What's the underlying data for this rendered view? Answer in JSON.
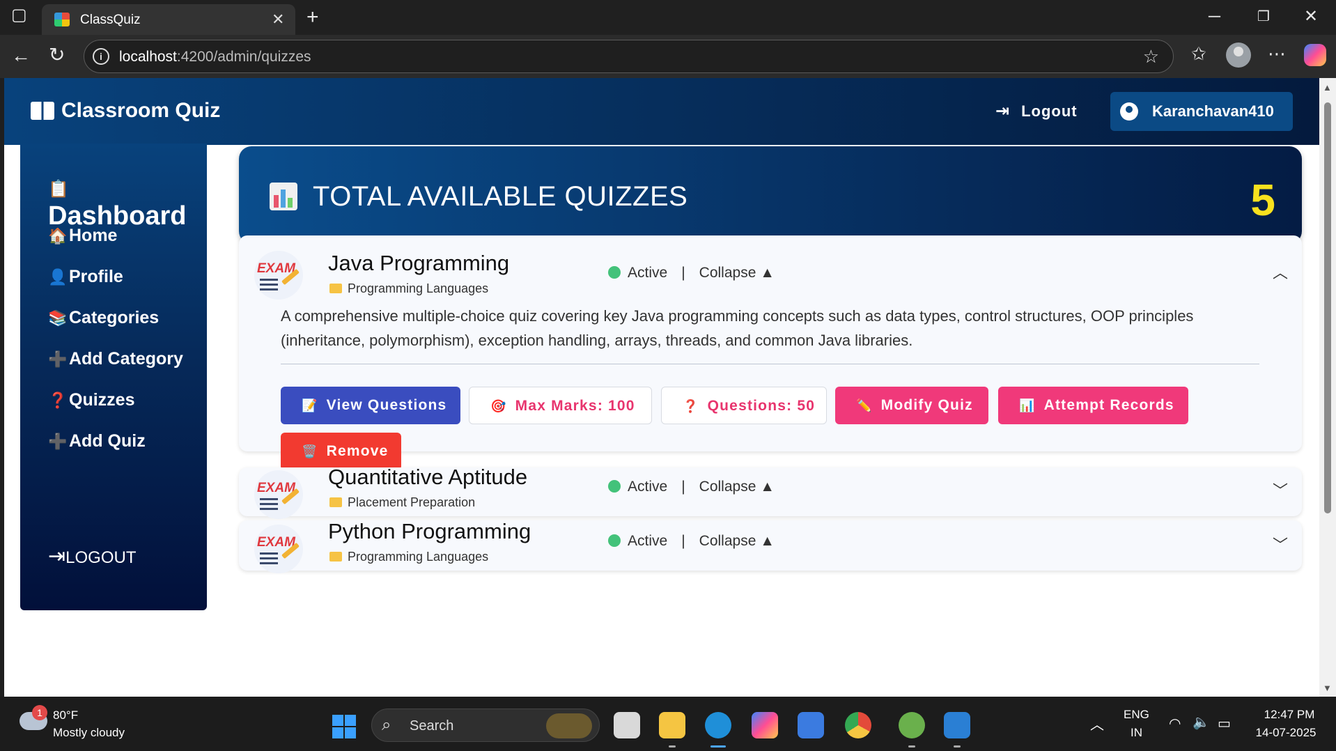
{
  "browser": {
    "tab_title": "ClassQuiz",
    "url_host": "localhost",
    "url_path": ":4200/admin/quizzes"
  },
  "header": {
    "brand": "Classroom Quiz",
    "logout": "Logout",
    "username": "Karanchavan410"
  },
  "sidebar": {
    "title": "Dashboard",
    "items": [
      {
        "label": "Home",
        "icon": "🏠"
      },
      {
        "label": "Profile",
        "icon": "👤"
      },
      {
        "label": "Categories",
        "icon": "📚"
      },
      {
        "label": "Add Category",
        "icon": "➕"
      },
      {
        "label": "Quizzes",
        "icon": "❓"
      },
      {
        "label": "Add Quiz",
        "icon": "➕"
      }
    ],
    "logout": "LOGOUT"
  },
  "banner": {
    "title": "TOTAL AVAILABLE QUIZZES",
    "count": "5"
  },
  "quizzes": [
    {
      "title": "Java Programming",
      "category": "Programming Languages",
      "status": "Active",
      "toggle": "Collapse ▲",
      "description": "A comprehensive multiple-choice quiz covering key Java programming concepts such as data types, control structures, OOP principles (inheritance, polymorphism), exception handling, arrays, threads, and common Java libraries.",
      "buttons": {
        "view": "View Questions",
        "max_marks": "Max Marks: 100",
        "questions": "Questions: 50",
        "modify": "Modify Quiz",
        "attempts": "Attempt Records",
        "remove": "Remove"
      }
    },
    {
      "title": "Quantitative Aptitude",
      "category": "Placement Preparation",
      "status": "Active",
      "toggle": "Collapse ▲"
    },
    {
      "title": "Python Programming",
      "category": "Programming Languages",
      "status": "Active",
      "toggle": "Collapse ▲"
    }
  ],
  "taskbar": {
    "badge": "1",
    "temperature": "80°F",
    "weather": "Mostly cloudy",
    "search": "Search",
    "lang1": "ENG",
    "lang2": "IN",
    "time": "12:47 PM",
    "date": "14-07-2025"
  },
  "colors": {
    "header_start": "#08427c",
    "header_end": "#041a3d",
    "count_yellow": "#f9e11e",
    "active_green": "#43c27a",
    "btn_blue": "#3a4dbf",
    "btn_pink": "#f0397a",
    "btn_red": "#f23a30"
  }
}
